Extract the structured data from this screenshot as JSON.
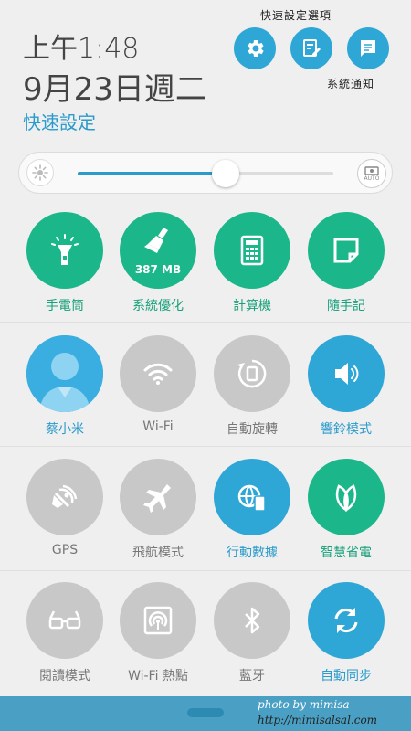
{
  "header": {
    "time": "上午1:48",
    "date": "9月23日週二",
    "title": "快速設定",
    "annotation_top": "快速設定選項",
    "annotation_right": "系統通知"
  },
  "header_buttons": [
    {
      "name": "settings-button",
      "icon": "gear-icon"
    },
    {
      "name": "edit-button",
      "icon": "edit-icon"
    },
    {
      "name": "notifications-button",
      "icon": "notification-icon"
    }
  ],
  "brightness": {
    "level": 0.58,
    "auto_label": "AUTO"
  },
  "tiles": [
    {
      "label": "手電筒",
      "state": "green",
      "icon": "flashlight-icon"
    },
    {
      "label": "系統優化",
      "state": "green",
      "icon": "broom-icon",
      "extra": "387 MB"
    },
    {
      "label": "計算機",
      "state": "green",
      "icon": "calculator-icon"
    },
    {
      "label": "隨手記",
      "state": "green",
      "icon": "note-icon"
    },
    {
      "label": "蔡小米",
      "state": "blue",
      "icon": "user-avatar-icon"
    },
    {
      "label": "Wi-Fi",
      "state": "grey",
      "icon": "wifi-icon"
    },
    {
      "label": "自動旋轉",
      "state": "grey",
      "icon": "rotate-icon"
    },
    {
      "label": "響鈴模式",
      "state": "blue",
      "icon": "speaker-icon"
    },
    {
      "label": "GPS",
      "state": "grey",
      "icon": "gps-icon"
    },
    {
      "label": "飛航模式",
      "state": "grey",
      "icon": "airplane-icon"
    },
    {
      "label": "行動數據",
      "state": "blue",
      "icon": "mobile-data-icon"
    },
    {
      "label": "智慧省電",
      "state": "green",
      "icon": "leaf-icon"
    },
    {
      "label": "閱讀模式",
      "state": "grey",
      "icon": "glasses-icon"
    },
    {
      "label": "Wi-Fi 熱點",
      "state": "grey",
      "icon": "hotspot-icon"
    },
    {
      "label": "藍牙",
      "state": "grey",
      "icon": "bluetooth-icon"
    },
    {
      "label": "自動同步",
      "state": "blue",
      "icon": "sync-icon"
    }
  ],
  "footer": {
    "credit_line1": "photo by mimisa",
    "credit_line2": "http://mimisalsal.com"
  },
  "colors": {
    "green": "#1bb78a",
    "blue": "#2fa7d6",
    "grey": "#c8c8c8",
    "accent": "#2a9bcb"
  }
}
